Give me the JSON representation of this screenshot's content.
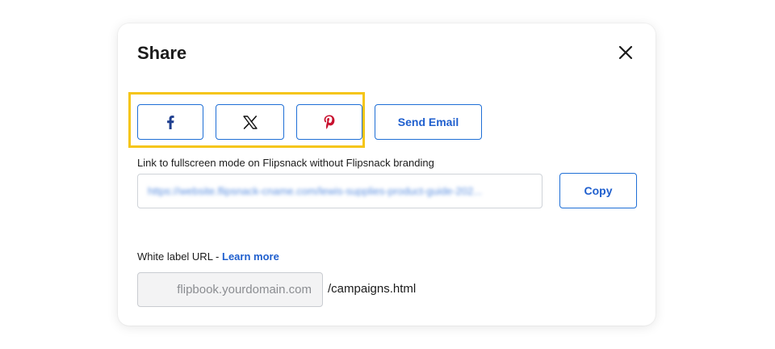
{
  "dialog": {
    "title": "Share",
    "close_icon": "close-icon"
  },
  "social": {
    "facebook_icon": "facebook-icon",
    "x_icon": "x-icon",
    "pinterest_icon": "pinterest-icon",
    "email_label": "Send Email",
    "highlight_color": "#f5c518"
  },
  "fullscreen_link": {
    "label": "Link to fullscreen mode on Flipsnack without Flipsnack branding",
    "url": "https://website.flipsnack-cname.com/lewis-supplies-product-guide-202...",
    "copy_label": "Copy"
  },
  "white_label": {
    "label": "White label URL - ",
    "learn_more": "Learn more",
    "domain_placeholder": "flipbook.yourdomain.com",
    "path_suffix": "/campaigns.html"
  },
  "colors": {
    "accent": "#1f5fce",
    "facebook": "#1f3f8f",
    "pinterest": "#c8102e",
    "x": "#111111"
  }
}
